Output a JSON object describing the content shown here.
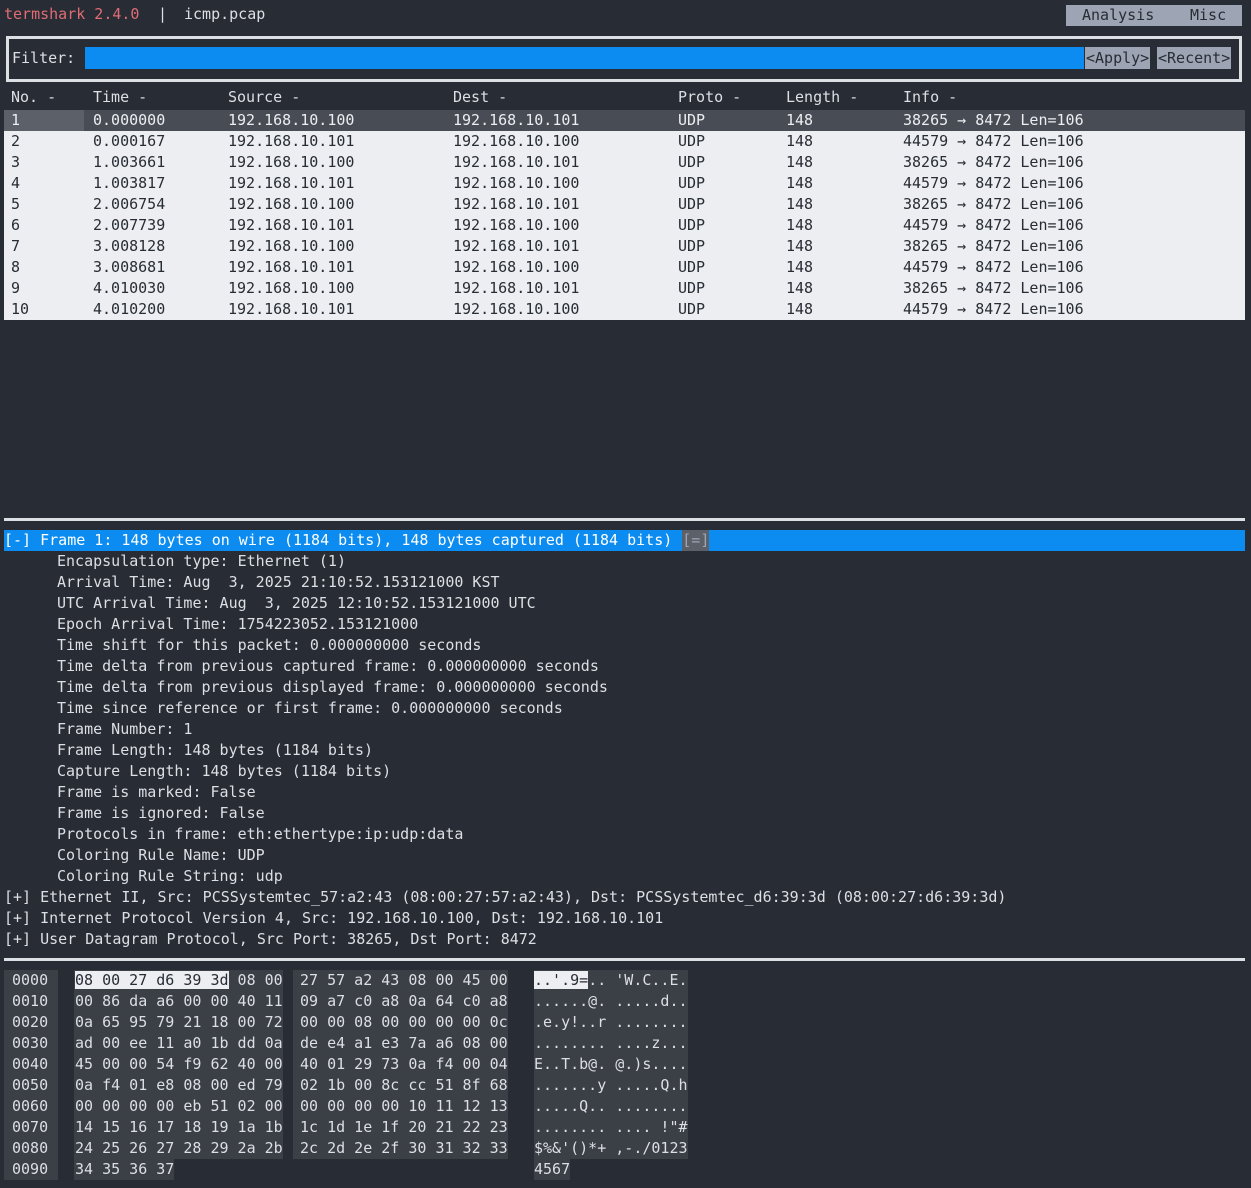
{
  "titlebar": {
    "app_name": "termshark 2.4.0",
    "separator": "|",
    "file_name": "icmp.pcap",
    "menu": {
      "analysis": "Analysis",
      "misc": "Misc"
    }
  },
  "filter": {
    "label": "Filter:",
    "value": "",
    "apply_label": "<Apply>",
    "recent_label": "<Recent>"
  },
  "packet_list": {
    "columns": [
      "No. -",
      "Time -",
      "Source -",
      "Dest -",
      "Proto -",
      "Length -",
      "Info -"
    ],
    "selected_index": 0,
    "rows": [
      [
        "1",
        "0.000000",
        "192.168.10.100",
        "192.168.10.101",
        "UDP",
        "148",
        "38265 → 8472 Len=106"
      ],
      [
        "2",
        "0.000167",
        "192.168.10.101",
        "192.168.10.100",
        "UDP",
        "148",
        "44579 → 8472 Len=106"
      ],
      [
        "3",
        "1.003661",
        "192.168.10.100",
        "192.168.10.101",
        "UDP",
        "148",
        "38265 → 8472 Len=106"
      ],
      [
        "4",
        "1.003817",
        "192.168.10.101",
        "192.168.10.100",
        "UDP",
        "148",
        "44579 → 8472 Len=106"
      ],
      [
        "5",
        "2.006754",
        "192.168.10.100",
        "192.168.10.101",
        "UDP",
        "148",
        "38265 → 8472 Len=106"
      ],
      [
        "6",
        "2.007739",
        "192.168.10.101",
        "192.168.10.100",
        "UDP",
        "148",
        "44579 → 8472 Len=106"
      ],
      [
        "7",
        "3.008128",
        "192.168.10.100",
        "192.168.10.101",
        "UDP",
        "148",
        "38265 → 8472 Len=106"
      ],
      [
        "8",
        "3.008681",
        "192.168.10.101",
        "192.168.10.100",
        "UDP",
        "148",
        "44579 → 8472 Len=106"
      ],
      [
        "9",
        "4.010030",
        "192.168.10.100",
        "192.168.10.101",
        "UDP",
        "148",
        "38265 → 8472 Len=106"
      ],
      [
        "10",
        "4.010200",
        "192.168.10.101",
        "192.168.10.100",
        "UDP",
        "148",
        "44579 → 8472 Len=106"
      ]
    ]
  },
  "details": {
    "frame_line": "[-] Frame 1: 148 bytes on wire (1184 bits), 148 bytes captured (1184 bits)",
    "frame_tail": "[=]",
    "frame_fields": [
      "Encapsulation type: Ethernet (1)",
      "Arrival Time: Aug  3, 2025 21:10:52.153121000 KST",
      "UTC Arrival Time: Aug  3, 2025 12:10:52.153121000 UTC",
      "Epoch Arrival Time: 1754223052.153121000",
      "Time shift for this packet: 0.000000000 seconds",
      "Time delta from previous captured frame: 0.000000000 seconds",
      "Time delta from previous displayed frame: 0.000000000 seconds",
      "Time since reference or first frame: 0.000000000 seconds",
      "Frame Number: 1",
      "Frame Length: 148 bytes (1184 bits)",
      "Capture Length: 148 bytes (1184 bits)",
      "Frame is marked: False",
      "Frame is ignored: False",
      "Protocols in frame: eth:ethertype:ip:udp:data",
      "Coloring Rule Name: UDP",
      "Coloring Rule String: udp"
    ],
    "collapsed": [
      "[+] Ethernet II, Src: PCSSystemtec_57:a2:43 (08:00:27:57:a2:43), Dst: PCSSystemtec_d6:39:3d (08:00:27:d6:39:3d)",
      "[+] Internet Protocol Version 4, Src: 192.168.10.100, Dst: 192.168.10.101",
      "[+] User Datagram Protocol, Src Port: 38265, Dst Port: 8472"
    ]
  },
  "hex": {
    "rows": [
      {
        "offset": "0000",
        "h1": "08 00 27 d6 39 3d 08 00",
        "h2": "27 57 a2 43 08 00 45 00",
        "a1": "..'.9=..",
        "a2": "'W.C..E."
      },
      {
        "offset": "0010",
        "h1": "00 86 da a6 00 00 40 11",
        "h2": "09 a7 c0 a8 0a 64 c0 a8",
        "a1": "......@.",
        "a2": ".....d.."
      },
      {
        "offset": "0020",
        "h1": "0a 65 95 79 21 18 00 72",
        "h2": "00 00 08 00 00 00 00 0c",
        "a1": ".e.y!..r",
        "a2": "........"
      },
      {
        "offset": "0030",
        "h1": "ad 00 ee 11 a0 1b dd 0a",
        "h2": "de e4 a1 e3 7a a6 08 00",
        "a1": "........",
        "a2": "....z..."
      },
      {
        "offset": "0040",
        "h1": "45 00 00 54 f9 62 40 00",
        "h2": "40 01 29 73 0a f4 00 04",
        "a1": "E..T.b@.",
        "a2": "@.)s...."
      },
      {
        "offset": "0050",
        "h1": "0a f4 01 e8 08 00 ed 79",
        "h2": "02 1b 00 8c cc 51 8f 68",
        "a1": ".......y",
        "a2": ".....Q.h"
      },
      {
        "offset": "0060",
        "h1": "00 00 00 00 eb 51 02 00",
        "h2": "00 00 00 00 10 11 12 13",
        "a1": ".....Q..",
        "a2": "........"
      },
      {
        "offset": "0070",
        "h1": "14 15 16 17 18 19 1a 1b",
        "h2": "1c 1d 1e 1f 20 21 22 23",
        "a1": "........",
        "a2": ".... !\"#"
      },
      {
        "offset": "0080",
        "h1": "24 25 26 27 28 29 2a 2b",
        "h2": "2c 2d 2e 2f 30 31 32 33",
        "a1": "$%&'()*+",
        "a2": ",-./0123"
      },
      {
        "offset": "0090",
        "h1": "34 35 36 37",
        "h2": "",
        "a1": "4567",
        "a2": ""
      }
    ]
  }
}
